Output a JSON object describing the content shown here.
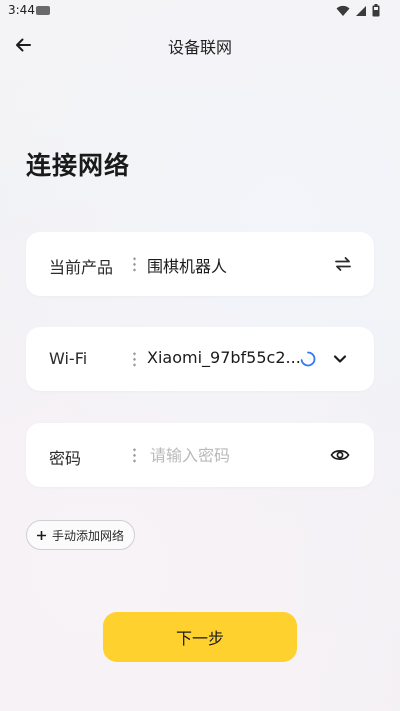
{
  "status_bar": {
    "time": "3:44"
  },
  "header": {
    "title": "设备联网"
  },
  "page": {
    "title": "连接网络"
  },
  "form": {
    "product": {
      "label": "当前产品",
      "value": "围棋机器人"
    },
    "wifi": {
      "label": "Wi-Fi",
      "value": "Xiaomi_97bf55c2..."
    },
    "password": {
      "label": "密码",
      "placeholder": "请输入密码",
      "value": ""
    }
  },
  "manual_add": {
    "label": "手动添加网络"
  },
  "actions": {
    "next_label": "下一步"
  },
  "colors": {
    "accent": "#fed12e",
    "spinner": "#2f7cf6"
  },
  "icons": {
    "back": "arrow-left-icon",
    "switch": "swap-arrows-icon",
    "loading": "loading-spinner-icon",
    "dropdown": "chevron-down-icon",
    "visibility": "eye-icon",
    "add": "plus-icon"
  }
}
